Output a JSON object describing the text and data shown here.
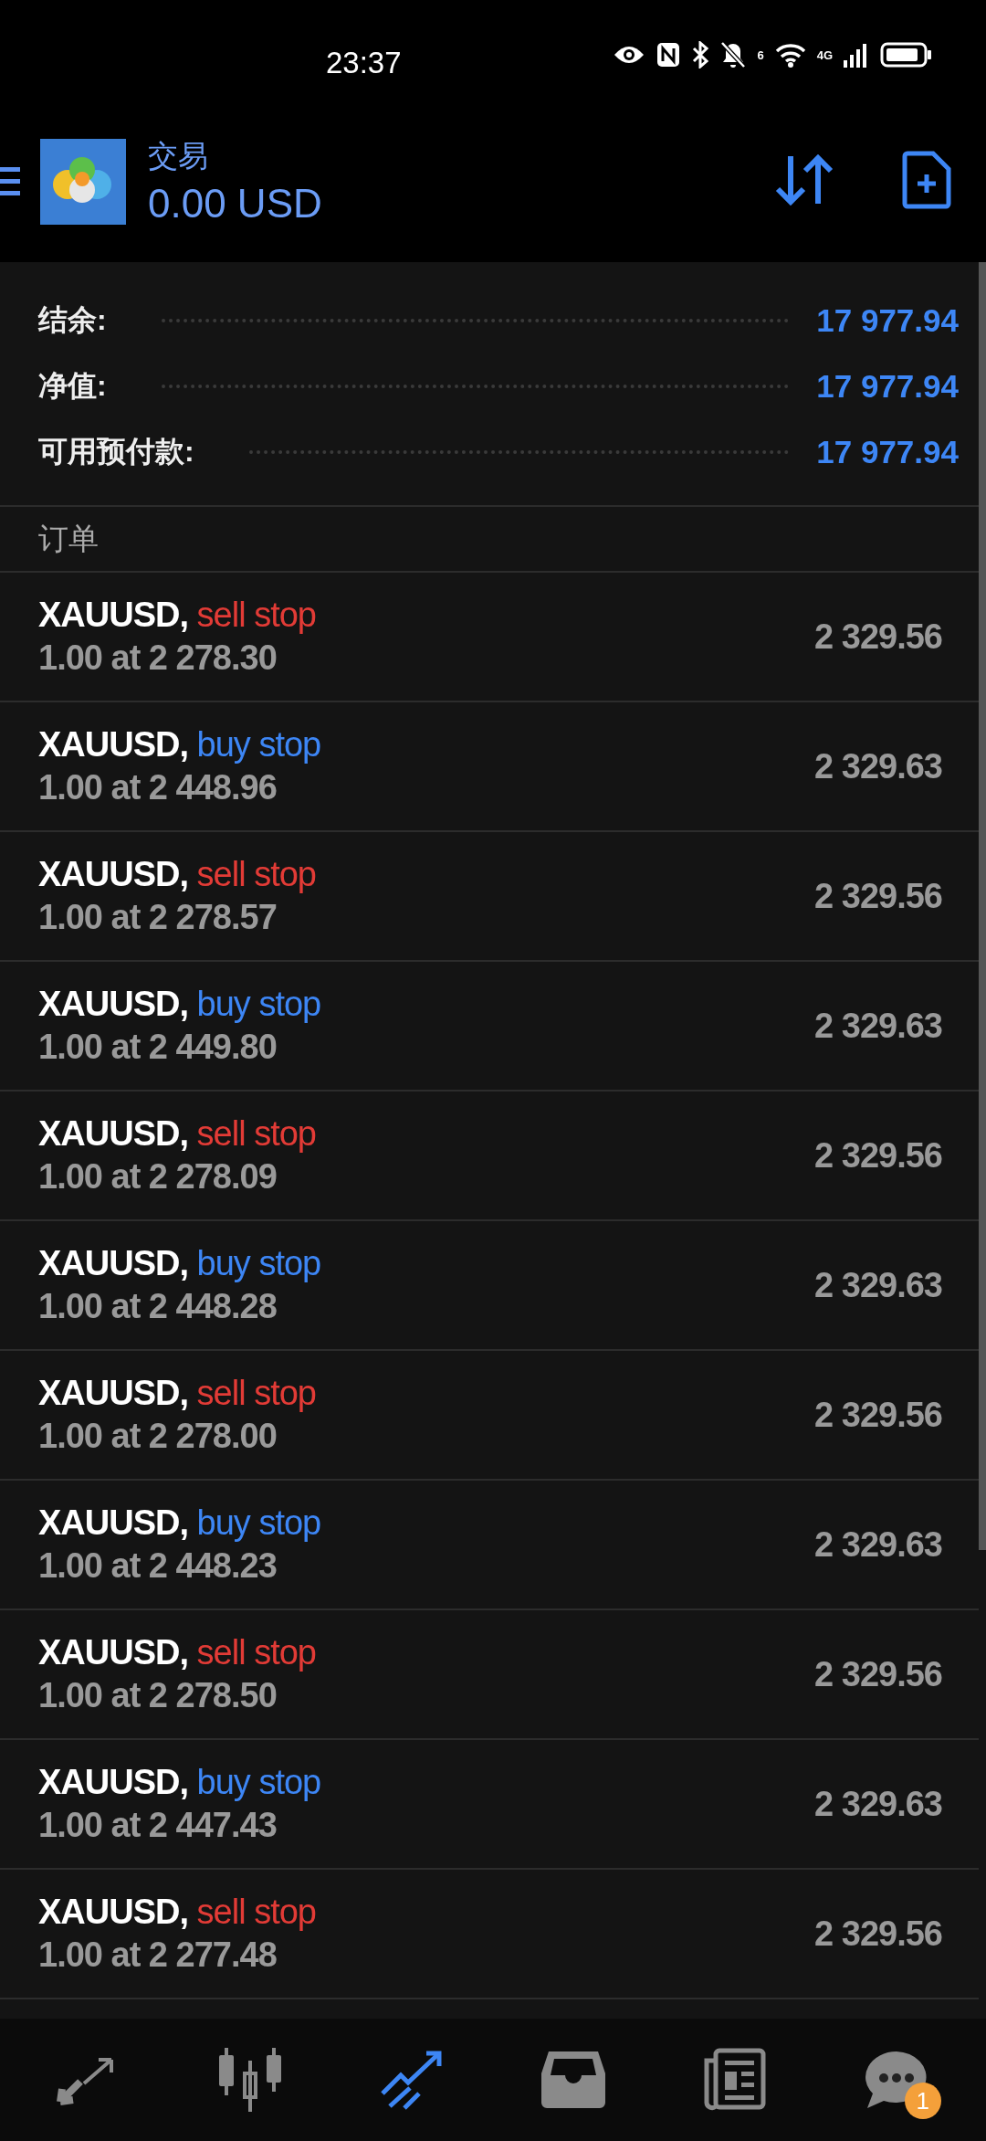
{
  "status_bar": {
    "time": "23:37",
    "wifi_badge": "6",
    "network": "4G"
  },
  "header": {
    "title": "交易",
    "balance": "0.00 USD"
  },
  "summary": [
    {
      "label": "结余:",
      "value": "17 977.94"
    },
    {
      "label": "净值:",
      "value": "17 977.94"
    },
    {
      "label": "可用预付款:",
      "value": "17 977.94"
    }
  ],
  "section_title": "订单",
  "orders": [
    {
      "symbol": "XAUUSD,",
      "type": "sell stop",
      "kind": "sell",
      "detail": "1.00 at 2 278.30",
      "price": "2 329.56"
    },
    {
      "symbol": "XAUUSD,",
      "type": "buy stop",
      "kind": "buy",
      "detail": "1.00 at 2 448.96",
      "price": "2 329.63"
    },
    {
      "symbol": "XAUUSD,",
      "type": "sell stop",
      "kind": "sell",
      "detail": "1.00 at 2 278.57",
      "price": "2 329.56"
    },
    {
      "symbol": "XAUUSD,",
      "type": "buy stop",
      "kind": "buy",
      "detail": "1.00 at 2 449.80",
      "price": "2 329.63"
    },
    {
      "symbol": "XAUUSD,",
      "type": "sell stop",
      "kind": "sell",
      "detail": "1.00 at 2 278.09",
      "price": "2 329.56"
    },
    {
      "symbol": "XAUUSD,",
      "type": "buy stop",
      "kind": "buy",
      "detail": "1.00 at 2 448.28",
      "price": "2 329.63"
    },
    {
      "symbol": "XAUUSD,",
      "type": "sell stop",
      "kind": "sell",
      "detail": "1.00 at 2 278.00",
      "price": "2 329.56"
    },
    {
      "symbol": "XAUUSD,",
      "type": "buy stop",
      "kind": "buy",
      "detail": "1.00 at 2 448.23",
      "price": "2 329.63"
    },
    {
      "symbol": "XAUUSD,",
      "type": "sell stop",
      "kind": "sell",
      "detail": "1.00 at 2 278.50",
      "price": "2 329.56"
    },
    {
      "symbol": "XAUUSD,",
      "type": "buy stop",
      "kind": "buy",
      "detail": "1.00 at 2 447.43",
      "price": "2 329.63"
    },
    {
      "symbol": "XAUUSD,",
      "type": "sell stop",
      "kind": "sell",
      "detail": "1.00 at 2 277.48",
      "price": "2 329.56"
    }
  ],
  "nav": [
    {
      "kind": "quotes",
      "selected": false
    },
    {
      "kind": "chart",
      "selected": false
    },
    {
      "kind": "trade",
      "selected": true
    },
    {
      "kind": "history",
      "selected": false
    },
    {
      "kind": "news",
      "selected": false
    },
    {
      "kind": "chat",
      "selected": false,
      "badge": "1"
    }
  ]
}
